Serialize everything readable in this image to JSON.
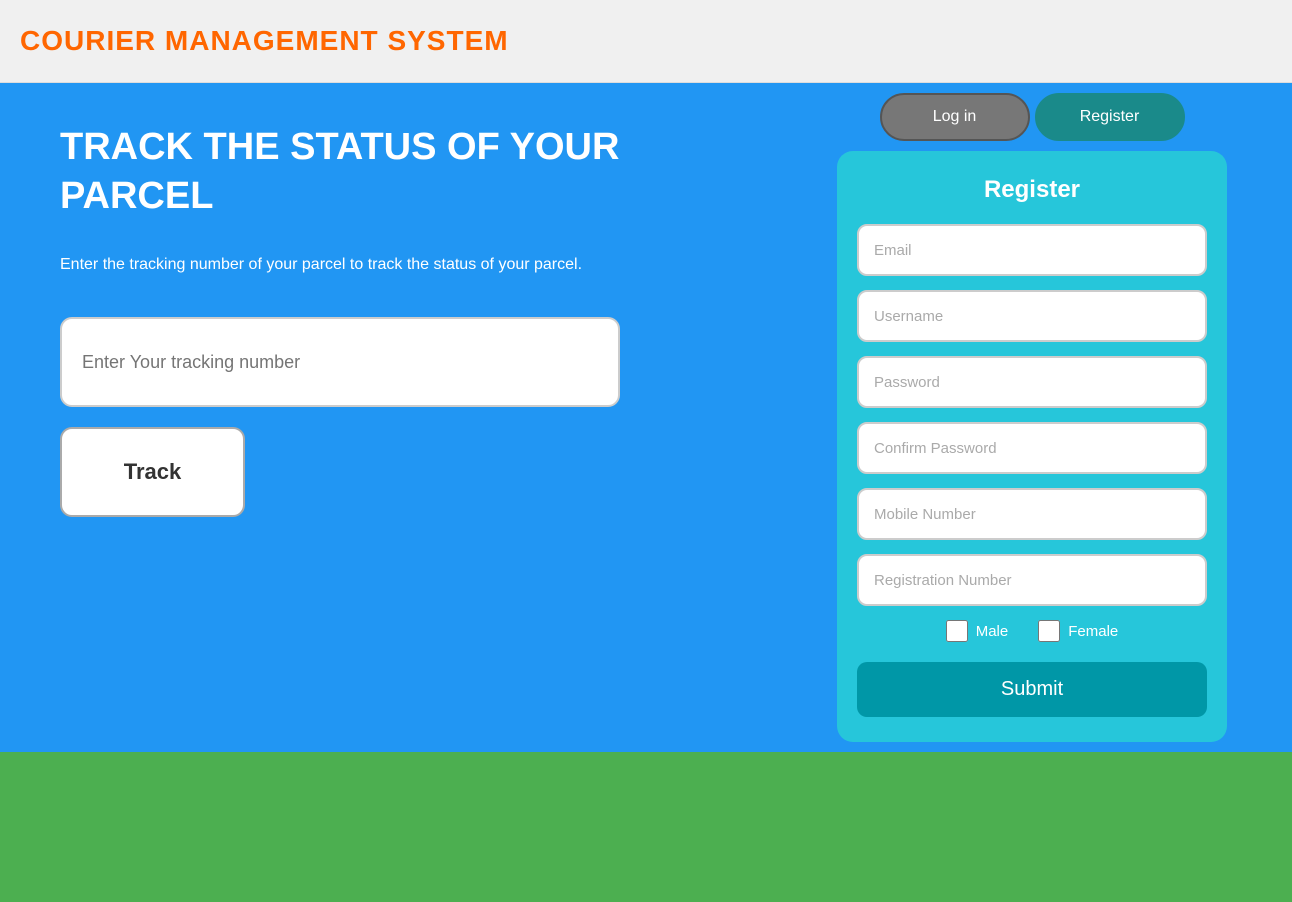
{
  "header": {
    "title": "COURIER MANAGEMENT SYSTEM"
  },
  "hero": {
    "title": "TRACK THE STATUS OF YOUR PARCEL",
    "description": "Enter the tracking number of your parcel to track the status of your parcel.",
    "tracking_placeholder": "Enter Your tracking number",
    "track_button_label": "Track"
  },
  "tabs": [
    {
      "id": "login",
      "label": "Log in",
      "active": false
    },
    {
      "id": "register",
      "label": "Register",
      "active": true
    }
  ],
  "register_form": {
    "title": "Register",
    "fields": [
      {
        "id": "email",
        "placeholder": "Email",
        "type": "email"
      },
      {
        "id": "username",
        "placeholder": "Username",
        "type": "text"
      },
      {
        "id": "password",
        "placeholder": "Password",
        "type": "password"
      },
      {
        "id": "confirm_password",
        "placeholder": "Confirm Password",
        "type": "password"
      },
      {
        "id": "mobile_number",
        "placeholder": "Mobile Number",
        "type": "tel"
      },
      {
        "id": "registration_number",
        "placeholder": "Registration Number",
        "type": "text"
      }
    ],
    "gender_options": [
      {
        "id": "male",
        "label": "Male"
      },
      {
        "id": "female",
        "label": "Female"
      }
    ],
    "submit_label": "Submit"
  }
}
